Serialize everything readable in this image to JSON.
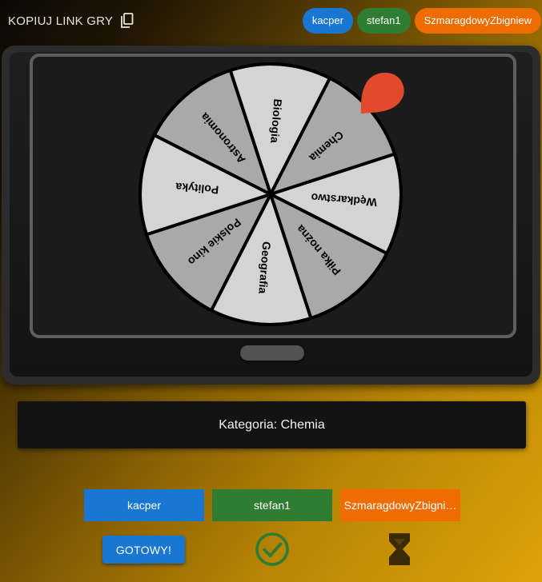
{
  "header": {
    "copy_link_label": "KOPIUJ LINK GRY",
    "copy_icon": "content-copy-icon",
    "players": [
      {
        "name": "kacper",
        "color": "#1976d2"
      },
      {
        "name": "stefan1",
        "color": "#2e7d32"
      },
      {
        "name": "SzmaragdowyZbigniew",
        "color": "#ef6c00"
      }
    ]
  },
  "wheel": {
    "pointer_color": "#e24a2c",
    "colors": {
      "light": "#d4d4d4",
      "dark": "#a9a9a9",
      "line": "#000000"
    },
    "segments": [
      {
        "label": "Biologia",
        "shade": "light"
      },
      {
        "label": "Chemia",
        "shade": "dark"
      },
      {
        "label": "Wędkarstwo",
        "shade": "light"
      },
      {
        "label": "Piłka nożna",
        "shade": "dark"
      },
      {
        "label": "Geografia",
        "shade": "light"
      },
      {
        "label": "Polskie kino",
        "shade": "dark"
      },
      {
        "label": "Polityka",
        "shade": "light"
      },
      {
        "label": "Astronomia",
        "shade": "dark"
      }
    ]
  },
  "category": {
    "label": "Kategoria:",
    "value": "Chemia"
  },
  "bottom": {
    "players": [
      {
        "name": "kacper",
        "display": "kacper",
        "color": "#1976d2",
        "status": "ready",
        "status_icon": "check-circle-icon"
      },
      {
        "name": "stefan1",
        "display": "stefan1",
        "color": "#2e7d32",
        "status": "ready",
        "status_icon": "check-circle-icon"
      },
      {
        "name": "SzmaragdowyZbigniew",
        "display": "SzmaragdowyZbigni…",
        "color": "#ef6c00",
        "status": "waiting",
        "status_icon": "hourglass-icon"
      }
    ],
    "ready_button_label": "GOTOWY!",
    "ready_color": "#2e7d32",
    "waiting_color": "#3b2a05"
  }
}
